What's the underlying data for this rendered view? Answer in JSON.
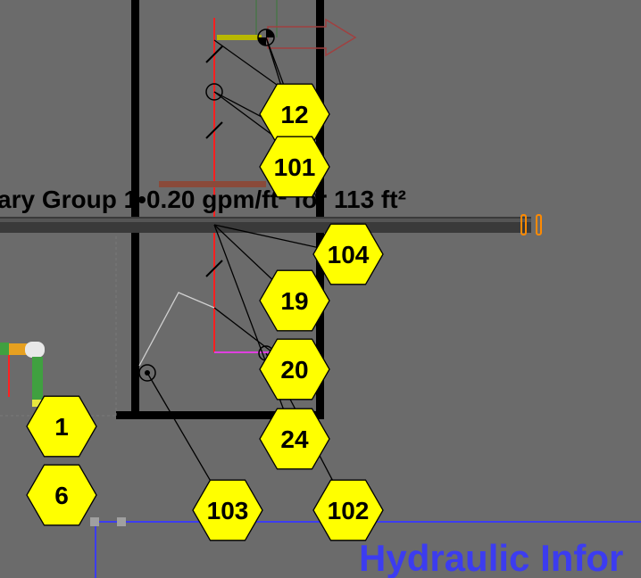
{
  "annotation": {
    "group_text": "ary Group 1•0.20 gpm/ft² for 113 ft²",
    "hydraulic_text": "Hydraulic Infor"
  },
  "tags": [
    {
      "id": "12"
    },
    {
      "id": "101"
    },
    {
      "id": "104"
    },
    {
      "id": "19"
    },
    {
      "id": "20"
    },
    {
      "id": "24"
    },
    {
      "id": "1"
    },
    {
      "id": "6"
    },
    {
      "id": "103"
    },
    {
      "id": "102"
    }
  ],
  "colors": {
    "background": "#6b6b6b",
    "wall": "#000000",
    "tag_fill": "#ffff00",
    "pipe_red": "#ff2020",
    "hydraulic_blue": "#3c3cf0",
    "pipe_gray": "#3a3a3a"
  }
}
